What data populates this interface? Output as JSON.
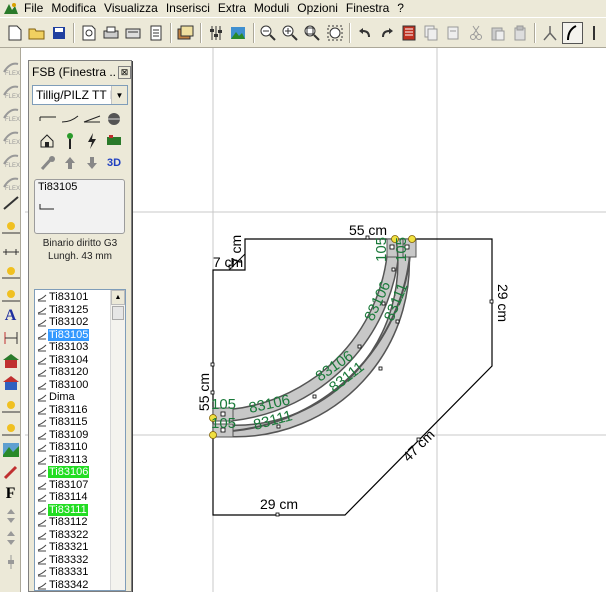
{
  "menubar": {
    "items": [
      "File",
      "Modifica",
      "Visualizza",
      "Inserisci",
      "Extra",
      "Moduli",
      "Opzioni",
      "Finestra",
      "?"
    ]
  },
  "toolbar": {
    "icons": [
      "new-file-icon",
      "open-folder-icon",
      "save-icon",
      "print-preview-icon",
      "print-icon",
      "page-setup-icon",
      "layers-icon",
      "library-icon",
      "settings-icon",
      "3d-view-icon",
      "zoom-out-icon",
      "zoom-in-icon",
      "zoom-window-icon",
      "zoom-fit-icon",
      "undo-icon",
      "redo-icon",
      "parts-list-icon",
      "copy-icon",
      "paste-icon",
      "cut-icon",
      "clipboard-icon",
      "duplicate-icon",
      "switch-tool-icon",
      "track-tool-icon"
    ]
  },
  "fsb": {
    "title": "FSB (Finestra ...",
    "close": "⊠",
    "selected_library": "Tillig/PILZ  TT I",
    "preview_code": "Ti83105",
    "desc_line1": "Binario diritto G3",
    "desc_line2": "Lungh. 43 mm",
    "items": [
      {
        "label": "Ti83101",
        "state": ""
      },
      {
        "label": "Ti83125",
        "state": ""
      },
      {
        "label": "Ti83102",
        "state": ""
      },
      {
        "label": "Ti83105",
        "state": "sel"
      },
      {
        "label": "Ti83103",
        "state": ""
      },
      {
        "label": "Ti83104",
        "state": ""
      },
      {
        "label": "Ti83120",
        "state": ""
      },
      {
        "label": "Ti83100",
        "state": ""
      },
      {
        "label": "Dima",
        "state": ""
      },
      {
        "label": "Ti83116",
        "state": ""
      },
      {
        "label": "Ti83115",
        "state": ""
      },
      {
        "label": "Ti83109",
        "state": ""
      },
      {
        "label": "Ti83110",
        "state": ""
      },
      {
        "label": "Ti83113",
        "state": ""
      },
      {
        "label": "Ti83106",
        "state": "green"
      },
      {
        "label": "Ti83107",
        "state": ""
      },
      {
        "label": "Ti83114",
        "state": ""
      },
      {
        "label": "Ti83111",
        "state": "green"
      },
      {
        "label": "Ti83112",
        "state": ""
      },
      {
        "label": "Ti83322",
        "state": ""
      },
      {
        "label": "Ti83321",
        "state": ""
      },
      {
        "label": "Ti83332",
        "state": ""
      },
      {
        "label": "Ti83331",
        "state": ""
      },
      {
        "label": "Ti83342",
        "state": ""
      }
    ]
  },
  "plan": {
    "dims": {
      "top": "55 cm",
      "top_left_v": "7 cm",
      "top_left_h": "7 cm",
      "left": "55 cm",
      "right": "29 cm",
      "diagonal": "47 cm",
      "bottom": "29 cm"
    },
    "track_labels": {
      "outer_straight_code": "105",
      "inner_straight_code": "105",
      "outer_first_curve": "83106",
      "outer_second_curve": "83106",
      "outer_third_curve": "83106",
      "inner_first_curve": "83111",
      "inner_second_curve": "83111",
      "inner_third_curve": "83111",
      "top_outer_code": "105",
      "top_inner_code": "105"
    },
    "colors": {
      "track_label": "#1a7a3a",
      "outline": "#000000",
      "grid": "#c8c8c8"
    }
  }
}
